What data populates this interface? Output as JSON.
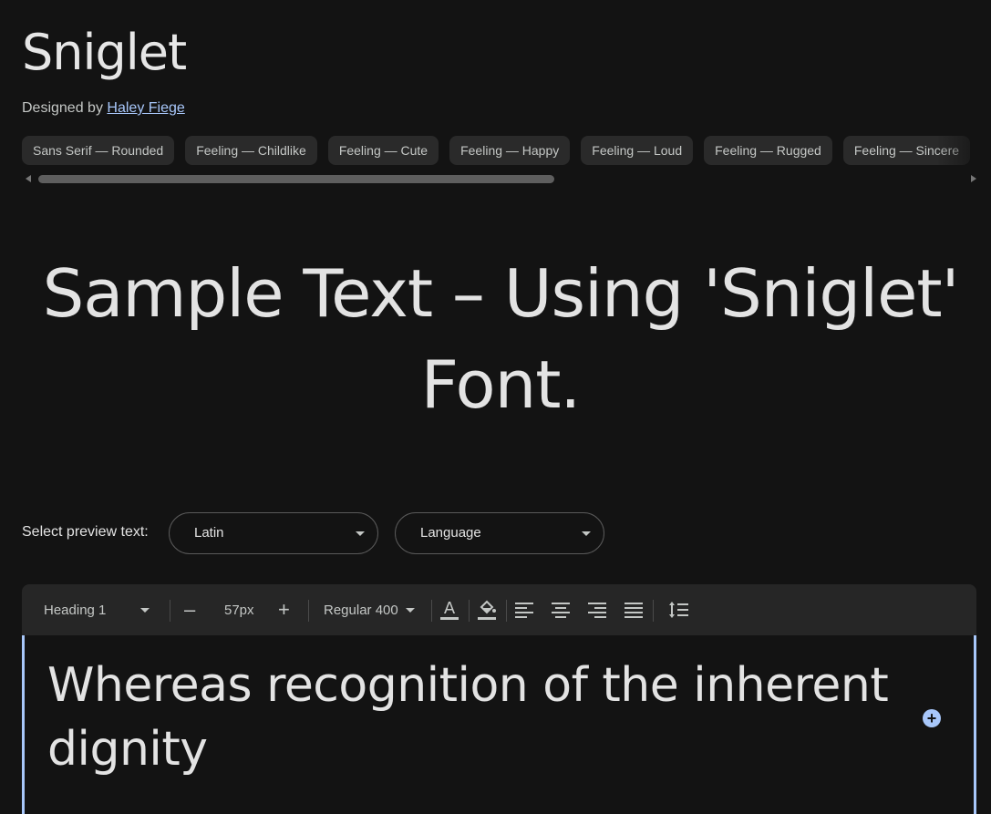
{
  "font": {
    "name": "Sniglet",
    "designed_by_label": "Designed by",
    "designer": "Haley Fiege"
  },
  "tags": [
    "Sans Serif — Rounded",
    "Feeling — Childlike",
    "Feeling — Cute",
    "Feeling — Happy",
    "Feeling — Loud",
    "Feeling — Rugged",
    "Feeling — Sincere"
  ],
  "hero": {
    "sample_text": "Sample Text – Using 'Sniglet' Font."
  },
  "preview": {
    "label": "Select preview text:",
    "script_select": "Latin",
    "language_select": "Language"
  },
  "toolbar": {
    "style_select": "Heading 1",
    "decrease_label": "–",
    "font_size": "57px",
    "increase_label": "+",
    "weight_select": "Regular 400"
  },
  "editor": {
    "text": "Whereas recognition of the inherent dignity"
  },
  "icons": {
    "text_color": "text-color-icon",
    "highlight": "fill-color-icon",
    "align_left": "align-left-icon",
    "align_center": "align-center-icon",
    "align_right": "align-right-icon",
    "align_justify": "align-justify-icon",
    "line_height": "line-height-icon",
    "add": "add-circle-icon"
  },
  "colors": {
    "background": "#131313",
    "accent": "#a8c7fa",
    "chip": "#2a2a2a",
    "toolbar": "#262626"
  }
}
